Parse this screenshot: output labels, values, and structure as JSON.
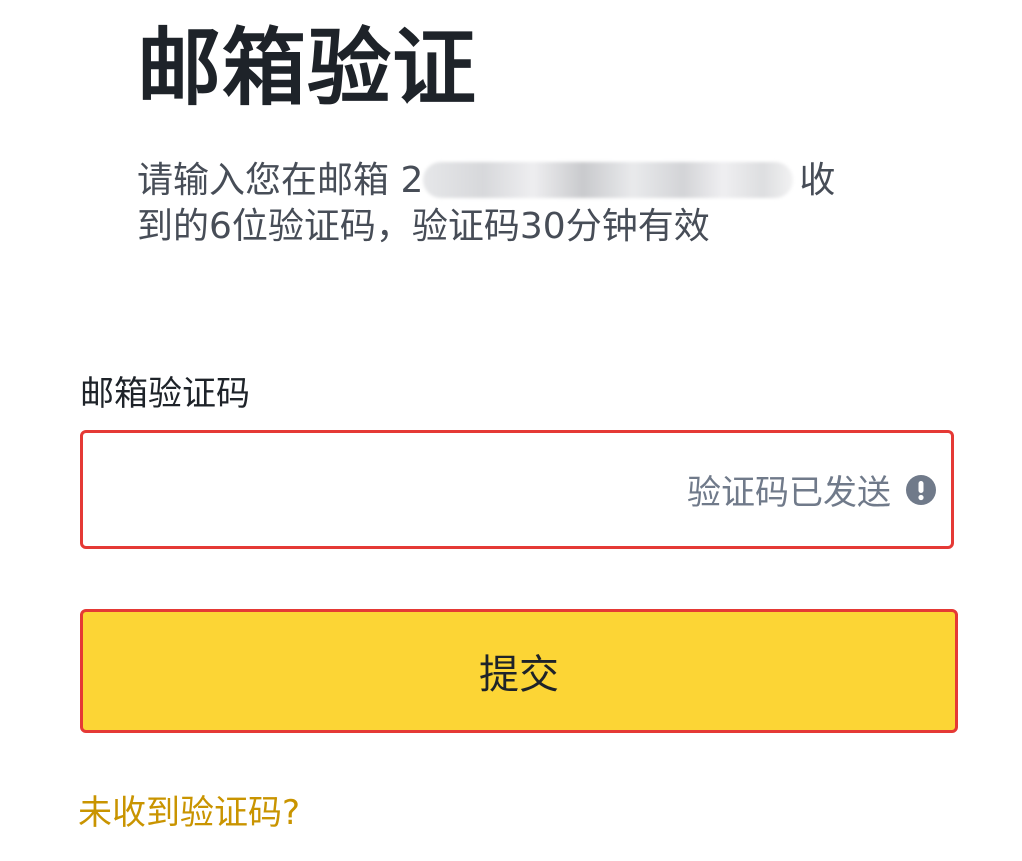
{
  "page": {
    "title": "邮箱验证"
  },
  "description": {
    "prefix": "请输入您在邮箱 2",
    "suffix": "收",
    "line2": "到的6位验证码，验证码30分钟有效"
  },
  "code_field": {
    "label": "邮箱验证码",
    "value": "",
    "placeholder": "",
    "status_text": "验证码已发送",
    "status_icon": "exclamation-circle-icon"
  },
  "submit": {
    "label": "提交"
  },
  "help": {
    "link_text": "未收到验证码?"
  },
  "colors": {
    "accent": "#fcd535",
    "error_border": "#e53935",
    "link": "#c99400",
    "muted_text": "#707a8a",
    "icon": "#707a8a"
  }
}
